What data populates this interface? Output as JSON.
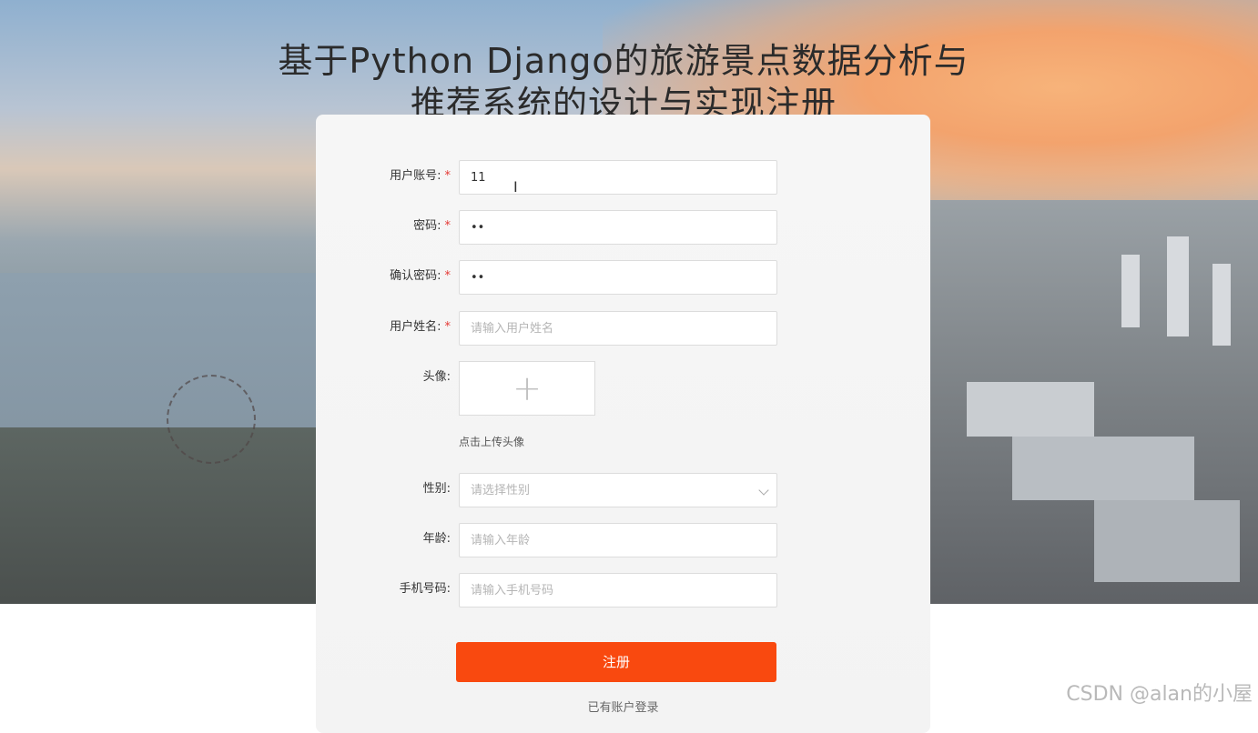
{
  "title": "基于Python Django的旅游景点数据分析与推荐系统的设计与实现注册",
  "form": {
    "account": {
      "label": "用户账号:",
      "required": "*",
      "value": "11"
    },
    "password": {
      "label": "密码:",
      "required": "*",
      "value": "••"
    },
    "confirm": {
      "label": "确认密码:",
      "required": "*",
      "value": "••"
    },
    "name": {
      "label": "用户姓名:",
      "required": "*",
      "placeholder": "请输入用户姓名"
    },
    "avatar": {
      "label": "头像:",
      "plus": "+",
      "hint": "点击上传头像"
    },
    "gender": {
      "label": "性别:",
      "placeholder": "请选择性别"
    },
    "age": {
      "label": "年龄:",
      "placeholder": "请输入年龄"
    },
    "phone": {
      "label": "手机号码:",
      "placeholder": "请输入手机号码"
    }
  },
  "submit_label": "注册",
  "login_link": "已有账户登录",
  "cursor_glyph": "I",
  "watermark": "CSDN @alan的小屋",
  "colors": {
    "accent": "#f9490f",
    "required": "#e53935"
  }
}
